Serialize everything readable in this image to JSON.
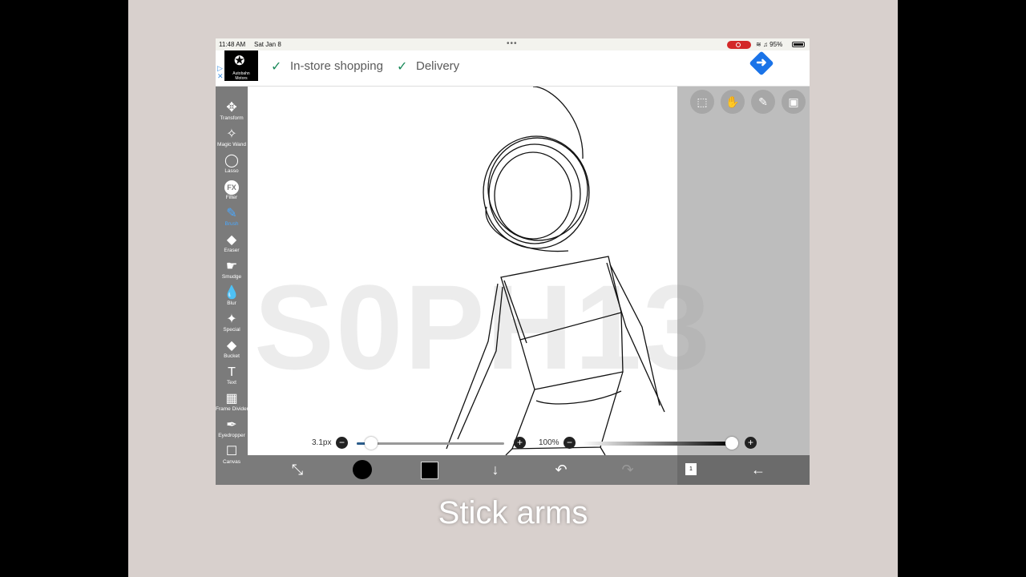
{
  "status_bar": {
    "time": "11:48 AM",
    "date": "Sat Jan 8",
    "battery": "95%"
  },
  "ad": {
    "choices_icon": "ad-choices-icon",
    "logo_text": "Autobahn Motors",
    "item_1": "In-store shopping",
    "item_2": "Delivery",
    "directions_icon": "directions-icon"
  },
  "tools": [
    {
      "label": "Transform",
      "icon": "✥"
    },
    {
      "label": "Magic Wand",
      "icon": "✧"
    },
    {
      "label": "Lasso",
      "icon": "◯"
    },
    {
      "label": "Filter",
      "icon": "FX"
    },
    {
      "label": "Brush",
      "icon": "✎",
      "active": true
    },
    {
      "label": "Eraser",
      "icon": "◆"
    },
    {
      "label": "Smudge",
      "icon": "☛"
    },
    {
      "label": "Blur",
      "icon": "💧"
    },
    {
      "label": "Special",
      "icon": "✦"
    },
    {
      "label": "Bucket",
      "icon": "◆"
    },
    {
      "label": "Text",
      "icon": "T"
    },
    {
      "label": "Frame Divider",
      "icon": "▦"
    },
    {
      "label": "Eyedropper",
      "icon": "✒"
    },
    {
      "label": "Canvas",
      "icon": "☐"
    }
  ],
  "watermark": "S0PH13",
  "brush_size": {
    "label": "3.1px",
    "value_fraction": 0.1
  },
  "opacity": {
    "label": "100%",
    "value_fraction": 1.0
  },
  "top_buttons": [
    "selection-icon",
    "hand-icon",
    "ruler-pen-icon",
    "image-icon"
  ],
  "bottom_bar": {
    "layer_count": "1"
  },
  "caption": "Stick arms",
  "colors": {
    "toolbar": "#7b7b7b",
    "accent": "#4aa8ff",
    "brush_color": "#000000"
  }
}
